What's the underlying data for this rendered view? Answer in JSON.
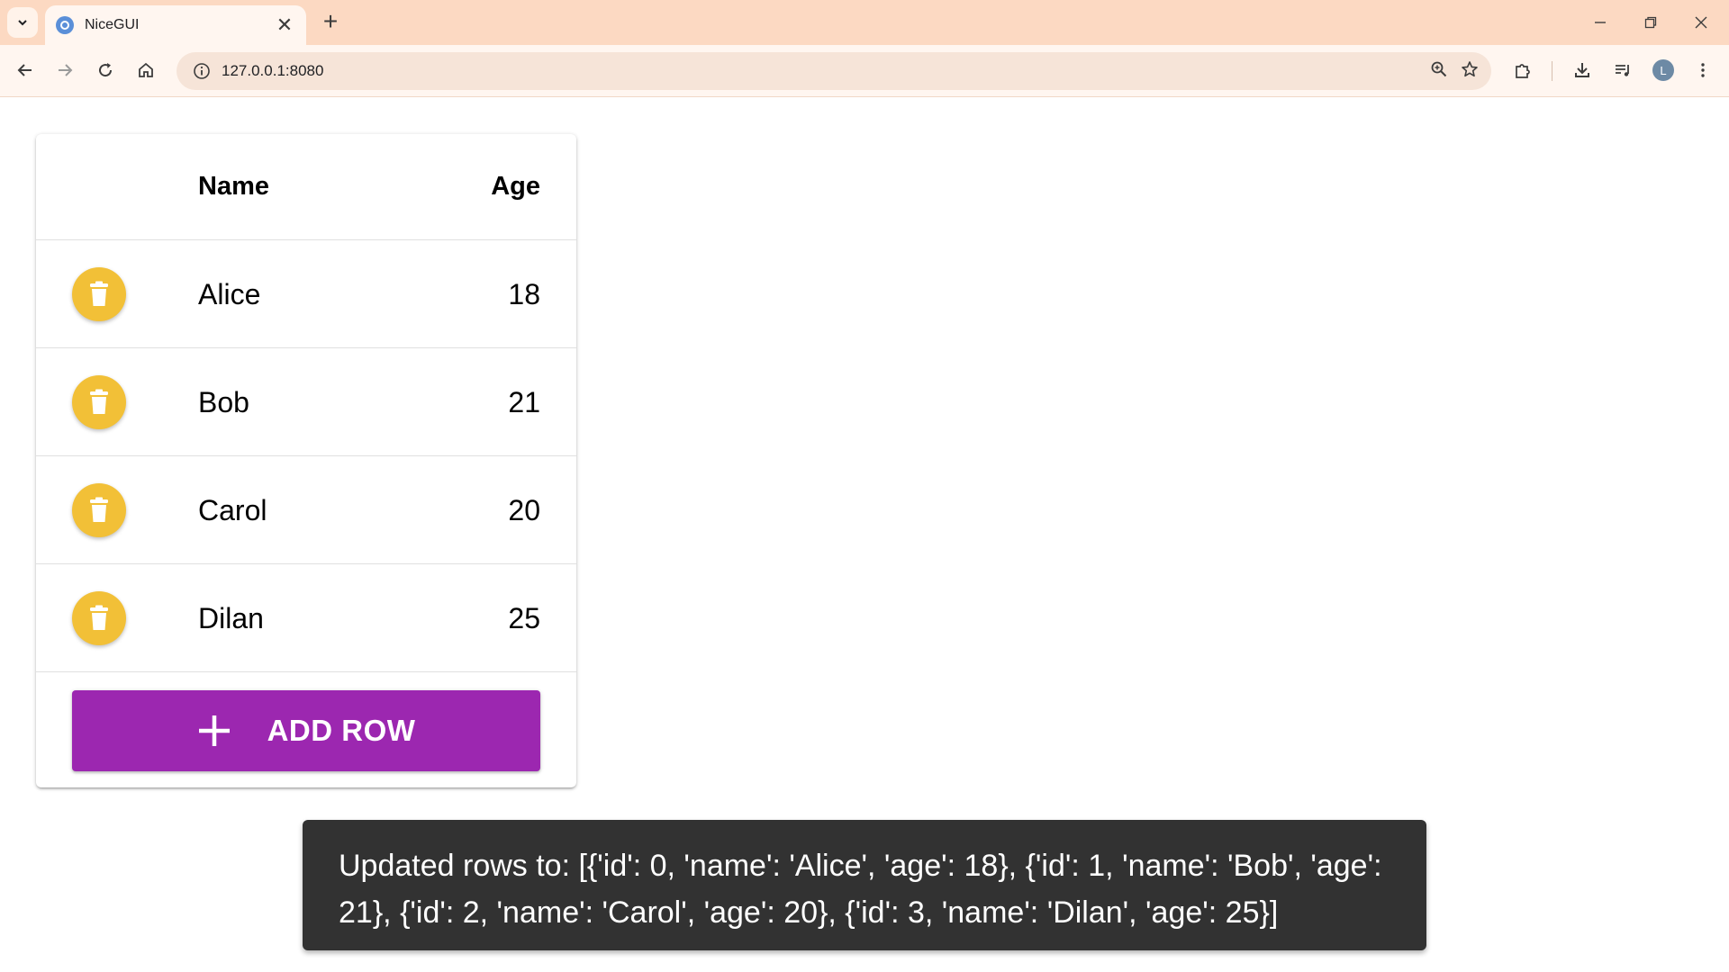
{
  "browser": {
    "tab_title": "NiceGUI",
    "tab_close": "✕",
    "new_tab": "+",
    "url": "127.0.0.1:8080",
    "profile_initial": "L"
  },
  "table": {
    "columns": [
      "Name",
      "Age"
    ],
    "rows": [
      {
        "name": "Alice",
        "age": "18"
      },
      {
        "name": "Bob",
        "age": "21"
      },
      {
        "name": "Carol",
        "age": "20"
      },
      {
        "name": "Dilan",
        "age": "25"
      }
    ],
    "add_button_label": "ADD ROW"
  },
  "notification": {
    "text": "Updated rows to: [{'id': 0, 'name': 'Alice', 'age': 18}, {'id': 1, 'name': 'Bob', 'age': 21}, {'id': 2, 'name': 'Carol', 'age': 20}, {'id': 3, 'name': 'Dilan', 'age': 25}]"
  },
  "colors": {
    "delete_button": "#f2c037",
    "add_button": "#9c27b0",
    "notification_bg": "#323232",
    "tabstrip_bg": "#fcd9c2"
  },
  "icons": {
    "row_action": "trash-icon",
    "add": "plus-icon"
  }
}
